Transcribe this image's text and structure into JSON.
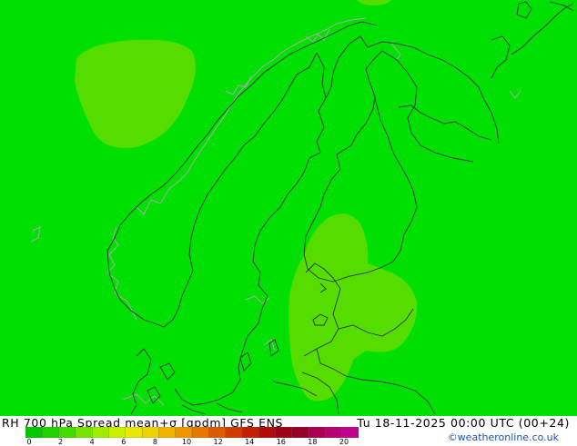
{
  "map": {
    "title": "RH 700 hPa Spread mean+σ [gpdm] GFS ENS",
    "valid_time": "Tu 18-11-2025 00:00 UTC (00+24)",
    "credit": "©weatheronline.co.uk",
    "colors": {
      "base_field": "#00e000",
      "low_field": "#55dd00",
      "coast": "#aaaaaa",
      "border": "#333333"
    }
  },
  "legend": {
    "ticks": [
      "0",
      "2",
      "4",
      "6",
      "8",
      "10",
      "12",
      "14",
      "16",
      "18",
      "20"
    ],
    "colors": [
      "#00c800",
      "#20d200",
      "#44dc00",
      "#74e400",
      "#a0ec00",
      "#c8f000",
      "#e8e800",
      "#f0d200",
      "#f0b400",
      "#ec9600",
      "#e47800",
      "#dc5a00",
      "#d03c00",
      "#c41e00",
      "#b40a0a",
      "#a00014",
      "#960028",
      "#a8004e",
      "#b40070",
      "#c00090"
    ]
  }
}
